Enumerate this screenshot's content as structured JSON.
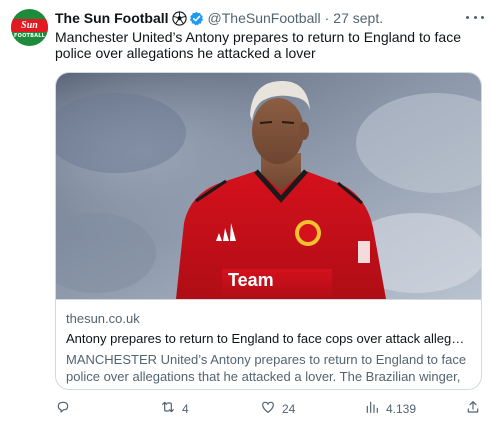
{
  "author": {
    "display_name": "The Sun Football",
    "handle": "@TheSunFootball",
    "separator": "·",
    "date": "27 sept.",
    "avatar_logo_text": "Sun",
    "avatar_sub_text": "FOOTBALL",
    "emoji_icon": "soccer-ball-icon",
    "verified_icon": "verified-badge-icon"
  },
  "tweet": {
    "text": "Manchester United’s Antony prepares to return to England to face police over allegations he attacked a lover"
  },
  "card": {
    "image_alt": "Antony in Manchester United kit",
    "shirt_text": "Team",
    "domain": "thesun.co.uk",
    "title": "Antony prepares to return to England to face cops over attack allegati...",
    "description": "MANCHESTER United’s Antony prepares to return to England to face police over allegations that he attacked a lover. The Brazilian winger, ..."
  },
  "actions": {
    "reply": {
      "icon": "reply-icon",
      "count": ""
    },
    "retweet": {
      "icon": "retweet-icon",
      "count": "4"
    },
    "like": {
      "icon": "heart-icon",
      "count": "24"
    },
    "views": {
      "icon": "views-icon",
      "count": "4.139"
    },
    "share": {
      "icon": "share-icon",
      "count": ""
    }
  },
  "colors": {
    "accent": "#1d9bf0",
    "text_primary": "#0f1419",
    "text_secondary": "#536471",
    "border": "#cfd9de",
    "shirt_red": "#d4111c"
  }
}
